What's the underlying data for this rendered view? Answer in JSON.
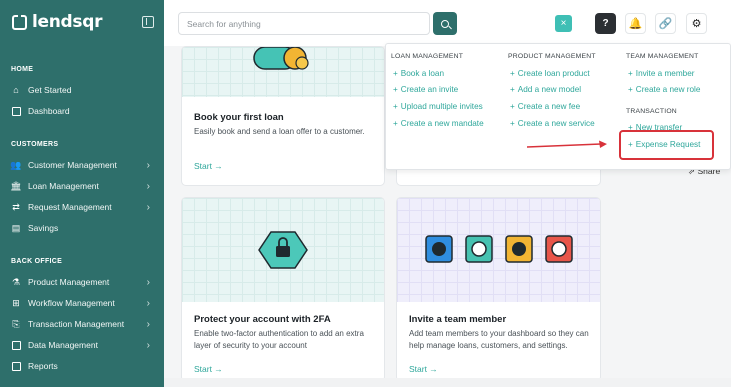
{
  "brand": {
    "name": "lendsqr"
  },
  "sidebar": {
    "sections": [
      {
        "title": "HOME",
        "items": [
          {
            "label": "Get Started",
            "icon": "home-icon"
          },
          {
            "label": "Dashboard",
            "icon": "dashboard-icon"
          }
        ]
      },
      {
        "title": "CUSTOMERS",
        "items": [
          {
            "label": "Customer Management",
            "icon": "users-icon"
          },
          {
            "label": "Loan Management",
            "icon": "bank-icon"
          },
          {
            "label": "Request Management",
            "icon": "request-icon"
          },
          {
            "label": "Savings",
            "icon": "savings-icon"
          }
        ]
      },
      {
        "title": "BACK OFFICE",
        "items": [
          {
            "label": "Product Management",
            "icon": "product-icon"
          },
          {
            "label": "Workflow Management",
            "icon": "workflow-icon"
          },
          {
            "label": "Transaction Management",
            "icon": "transaction-icon"
          },
          {
            "label": "Data Management",
            "icon": "data-icon"
          },
          {
            "label": "Reports",
            "icon": "reports-icon"
          }
        ]
      }
    ]
  },
  "topbar": {
    "search_placeholder": "Search for anything"
  },
  "cards": [
    {
      "title": "Book your first loan",
      "description": "Easily book and send a loan offer to a customer.",
      "cta": "Start →"
    },
    {
      "title": "Protect your account with 2FA",
      "description": "Enable two-factor authentication to add an extra layer of security to your account",
      "cta": "Start →"
    },
    {
      "title": "Invite a team member",
      "description": "Add team members to your dashboard so they can help manage loans, customers, and settings.",
      "cta": "Start →"
    }
  ],
  "dropdown": {
    "loan_management": {
      "title": "LOAN MANAGEMENT",
      "items": [
        "Book a loan",
        "Create an invite",
        "Upload multiple invites",
        "Create a new mandate"
      ]
    },
    "product_management": {
      "title": "PRODUCT MANAGEMENT",
      "items": [
        "Create loan product",
        "Add a new model",
        "Create a new fee",
        "Create a new service"
      ]
    },
    "team_management": {
      "title": "TEAM MANAGEMENT",
      "items": [
        "Invite a member",
        "Create a new role"
      ]
    },
    "transaction": {
      "title": "TRANSACTION",
      "items": [
        "New transfer",
        "Expense Request"
      ]
    }
  },
  "share_label": "Share",
  "colors": {
    "sidebar": "#2e6f6b",
    "accent": "#2fa79b",
    "highlight": "#d8323a"
  }
}
